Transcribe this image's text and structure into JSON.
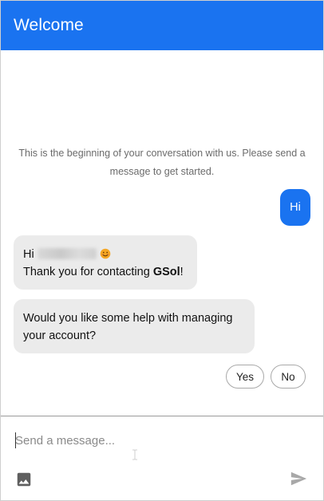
{
  "header": {
    "title": "Welcome"
  },
  "conversation": {
    "intro_text": "This is the beginning of your conversation with us. Please send a message to get started.",
    "messages": [
      {
        "sender": "user",
        "text": "Hi"
      },
      {
        "sender": "agent",
        "greeting": "Hi",
        "line2_prefix": "Thank you for contacting ",
        "brand": "GSol",
        "line2_suffix": "!"
      },
      {
        "sender": "agent",
        "text": "Would you like some help with managing your account?"
      }
    ],
    "quick_replies": [
      "Yes",
      "No"
    ]
  },
  "composer": {
    "placeholder": "Send a message...",
    "image_icon": "image-icon",
    "send_icon": "send-icon"
  },
  "colors": {
    "accent": "#1a73f0",
    "agent_bubble": "#ebebeb"
  }
}
